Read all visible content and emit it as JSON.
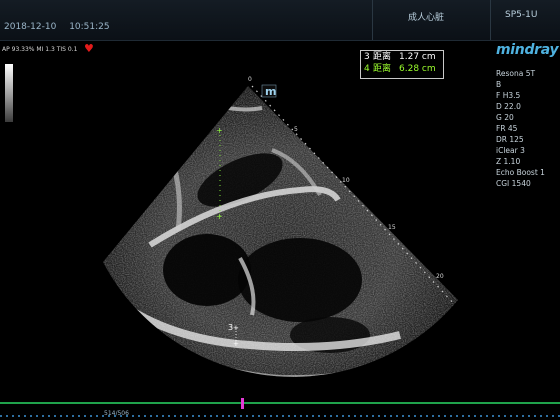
{
  "header": {
    "date": "2018-12-10",
    "time": "10:51:25",
    "preset": "成人心脏",
    "probe": "SP5-1U"
  },
  "acquisition_info": "AP 93.33%  MI 1.3  TIS 0.1",
  "brand": {
    "logo": "mindray"
  },
  "params": [
    "Resona 5T",
    "B",
    "F H3.5",
    "D 22.0",
    "G 20",
    "FR 45",
    "DR 125",
    "iClear 3",
    "Z 1.10",
    "Echo Boost 1",
    "CGI 1540"
  ],
  "measurements": [
    {
      "index": "3",
      "label": "距离",
      "value": "1.27 cm"
    },
    {
      "index": "4",
      "label": "距离",
      "value": "6.28 cm"
    }
  ],
  "depth_scale": [
    "0",
    "5",
    "10",
    "15",
    "20"
  ],
  "orientation_marker": "m",
  "caliper_label": "3",
  "cine": {
    "frames": "514/506"
  },
  "colors": {
    "measurement_active": "#9cff2d",
    "logo": "#4fb2e0",
    "cine_line": "#1fa24b",
    "cine_marker": "#e43ad6",
    "heart_icon": "#e21b1b"
  }
}
